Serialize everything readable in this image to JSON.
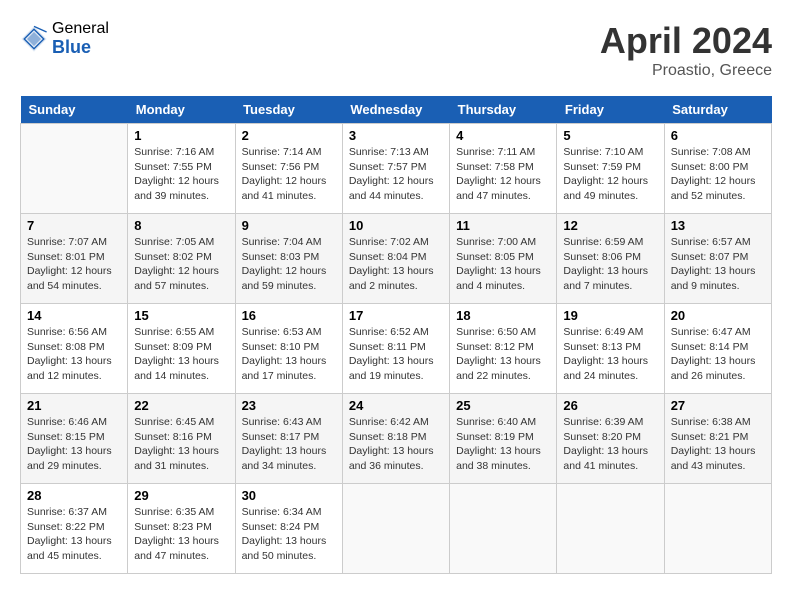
{
  "header": {
    "logo_general": "General",
    "logo_blue": "Blue",
    "title": "April 2024",
    "location": "Proastio, Greece"
  },
  "weekdays": [
    "Sunday",
    "Monday",
    "Tuesday",
    "Wednesday",
    "Thursday",
    "Friday",
    "Saturday"
  ],
  "weeks": [
    [
      {
        "day": "",
        "info": ""
      },
      {
        "day": "1",
        "info": "Sunrise: 7:16 AM\nSunset: 7:55 PM\nDaylight: 12 hours\nand 39 minutes."
      },
      {
        "day": "2",
        "info": "Sunrise: 7:14 AM\nSunset: 7:56 PM\nDaylight: 12 hours\nand 41 minutes."
      },
      {
        "day": "3",
        "info": "Sunrise: 7:13 AM\nSunset: 7:57 PM\nDaylight: 12 hours\nand 44 minutes."
      },
      {
        "day": "4",
        "info": "Sunrise: 7:11 AM\nSunset: 7:58 PM\nDaylight: 12 hours\nand 47 minutes."
      },
      {
        "day": "5",
        "info": "Sunrise: 7:10 AM\nSunset: 7:59 PM\nDaylight: 12 hours\nand 49 minutes."
      },
      {
        "day": "6",
        "info": "Sunrise: 7:08 AM\nSunset: 8:00 PM\nDaylight: 12 hours\nand 52 minutes."
      }
    ],
    [
      {
        "day": "7",
        "info": "Sunrise: 7:07 AM\nSunset: 8:01 PM\nDaylight: 12 hours\nand 54 minutes."
      },
      {
        "day": "8",
        "info": "Sunrise: 7:05 AM\nSunset: 8:02 PM\nDaylight: 12 hours\nand 57 minutes."
      },
      {
        "day": "9",
        "info": "Sunrise: 7:04 AM\nSunset: 8:03 PM\nDaylight: 12 hours\nand 59 minutes."
      },
      {
        "day": "10",
        "info": "Sunrise: 7:02 AM\nSunset: 8:04 PM\nDaylight: 13 hours\nand 2 minutes."
      },
      {
        "day": "11",
        "info": "Sunrise: 7:00 AM\nSunset: 8:05 PM\nDaylight: 13 hours\nand 4 minutes."
      },
      {
        "day": "12",
        "info": "Sunrise: 6:59 AM\nSunset: 8:06 PM\nDaylight: 13 hours\nand 7 minutes."
      },
      {
        "day": "13",
        "info": "Sunrise: 6:57 AM\nSunset: 8:07 PM\nDaylight: 13 hours\nand 9 minutes."
      }
    ],
    [
      {
        "day": "14",
        "info": "Sunrise: 6:56 AM\nSunset: 8:08 PM\nDaylight: 13 hours\nand 12 minutes."
      },
      {
        "day": "15",
        "info": "Sunrise: 6:55 AM\nSunset: 8:09 PM\nDaylight: 13 hours\nand 14 minutes."
      },
      {
        "day": "16",
        "info": "Sunrise: 6:53 AM\nSunset: 8:10 PM\nDaylight: 13 hours\nand 17 minutes."
      },
      {
        "day": "17",
        "info": "Sunrise: 6:52 AM\nSunset: 8:11 PM\nDaylight: 13 hours\nand 19 minutes."
      },
      {
        "day": "18",
        "info": "Sunrise: 6:50 AM\nSunset: 8:12 PM\nDaylight: 13 hours\nand 22 minutes."
      },
      {
        "day": "19",
        "info": "Sunrise: 6:49 AM\nSunset: 8:13 PM\nDaylight: 13 hours\nand 24 minutes."
      },
      {
        "day": "20",
        "info": "Sunrise: 6:47 AM\nSunset: 8:14 PM\nDaylight: 13 hours\nand 26 minutes."
      }
    ],
    [
      {
        "day": "21",
        "info": "Sunrise: 6:46 AM\nSunset: 8:15 PM\nDaylight: 13 hours\nand 29 minutes."
      },
      {
        "day": "22",
        "info": "Sunrise: 6:45 AM\nSunset: 8:16 PM\nDaylight: 13 hours\nand 31 minutes."
      },
      {
        "day": "23",
        "info": "Sunrise: 6:43 AM\nSunset: 8:17 PM\nDaylight: 13 hours\nand 34 minutes."
      },
      {
        "day": "24",
        "info": "Sunrise: 6:42 AM\nSunset: 8:18 PM\nDaylight: 13 hours\nand 36 minutes."
      },
      {
        "day": "25",
        "info": "Sunrise: 6:40 AM\nSunset: 8:19 PM\nDaylight: 13 hours\nand 38 minutes."
      },
      {
        "day": "26",
        "info": "Sunrise: 6:39 AM\nSunset: 8:20 PM\nDaylight: 13 hours\nand 41 minutes."
      },
      {
        "day": "27",
        "info": "Sunrise: 6:38 AM\nSunset: 8:21 PM\nDaylight: 13 hours\nand 43 minutes."
      }
    ],
    [
      {
        "day": "28",
        "info": "Sunrise: 6:37 AM\nSunset: 8:22 PM\nDaylight: 13 hours\nand 45 minutes."
      },
      {
        "day": "29",
        "info": "Sunrise: 6:35 AM\nSunset: 8:23 PM\nDaylight: 13 hours\nand 47 minutes."
      },
      {
        "day": "30",
        "info": "Sunrise: 6:34 AM\nSunset: 8:24 PM\nDaylight: 13 hours\nand 50 minutes."
      },
      {
        "day": "",
        "info": ""
      },
      {
        "day": "",
        "info": ""
      },
      {
        "day": "",
        "info": ""
      },
      {
        "day": "",
        "info": ""
      }
    ]
  ]
}
